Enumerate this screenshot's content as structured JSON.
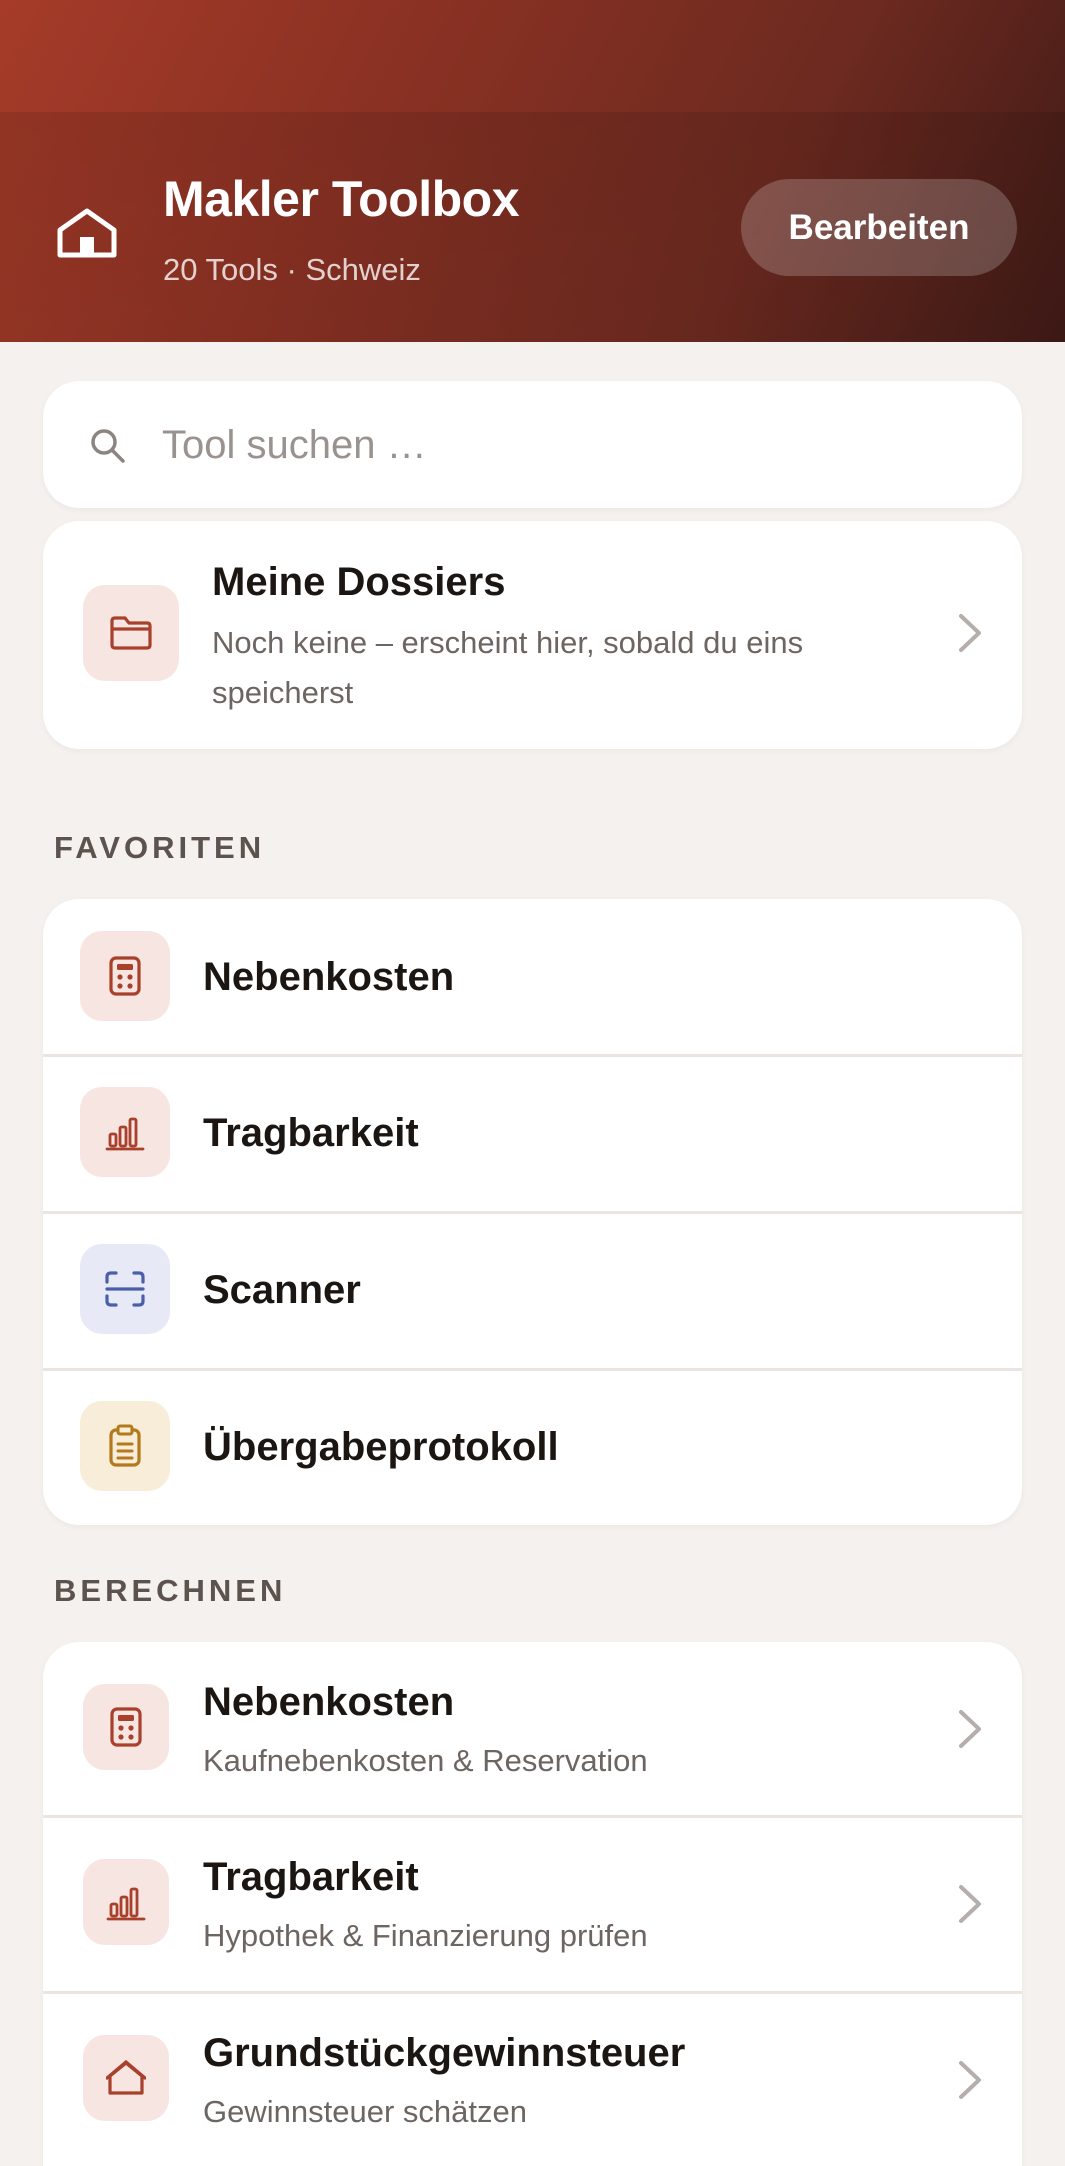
{
  "header": {
    "title": "Makler Toolbox",
    "subtitle": "20 Tools · Schweiz",
    "edit_label": "Bearbeiten",
    "home_icon": "home-icon"
  },
  "search": {
    "placeholder": "Tool suchen …",
    "value": ""
  },
  "dossiers": {
    "title": "Meine Dossiers",
    "description": "Noch keine – erscheint hier, sobald du eins speicherst",
    "icon": "folder-icon"
  },
  "favorites": {
    "label": "FAVORITEN",
    "items": [
      {
        "label": "Nebenkosten",
        "icon": "calculator-icon"
      },
      {
        "label": "Tragbarkeit",
        "icon": "bar-chart-icon"
      },
      {
        "label": "Scanner",
        "icon": "scan-icon"
      },
      {
        "label": "Übergabeprotokoll",
        "icon": "clipboard-icon"
      }
    ]
  },
  "calculate": {
    "label": "BERECHNEN",
    "items": [
      {
        "title": "Nebenkosten",
        "subtitle": "Kaufnebenkosten & Reservation",
        "icon": "calculator-icon"
      },
      {
        "title": "Tragbarkeit",
        "subtitle": "Hypothek & Finanzierung prüfen",
        "icon": "bar-chart-icon"
      },
      {
        "title": "Grundstückgewinnsteuer",
        "subtitle": "Gewinnsteuer schätzen",
        "icon": "house-icon"
      }
    ]
  },
  "colors": {
    "accent": "#a63b29",
    "icon_red": "#a8402c",
    "icon_blue": "#4a5fa8",
    "icon_yellow": "#b3791c",
    "background": "#f5f1ee"
  }
}
